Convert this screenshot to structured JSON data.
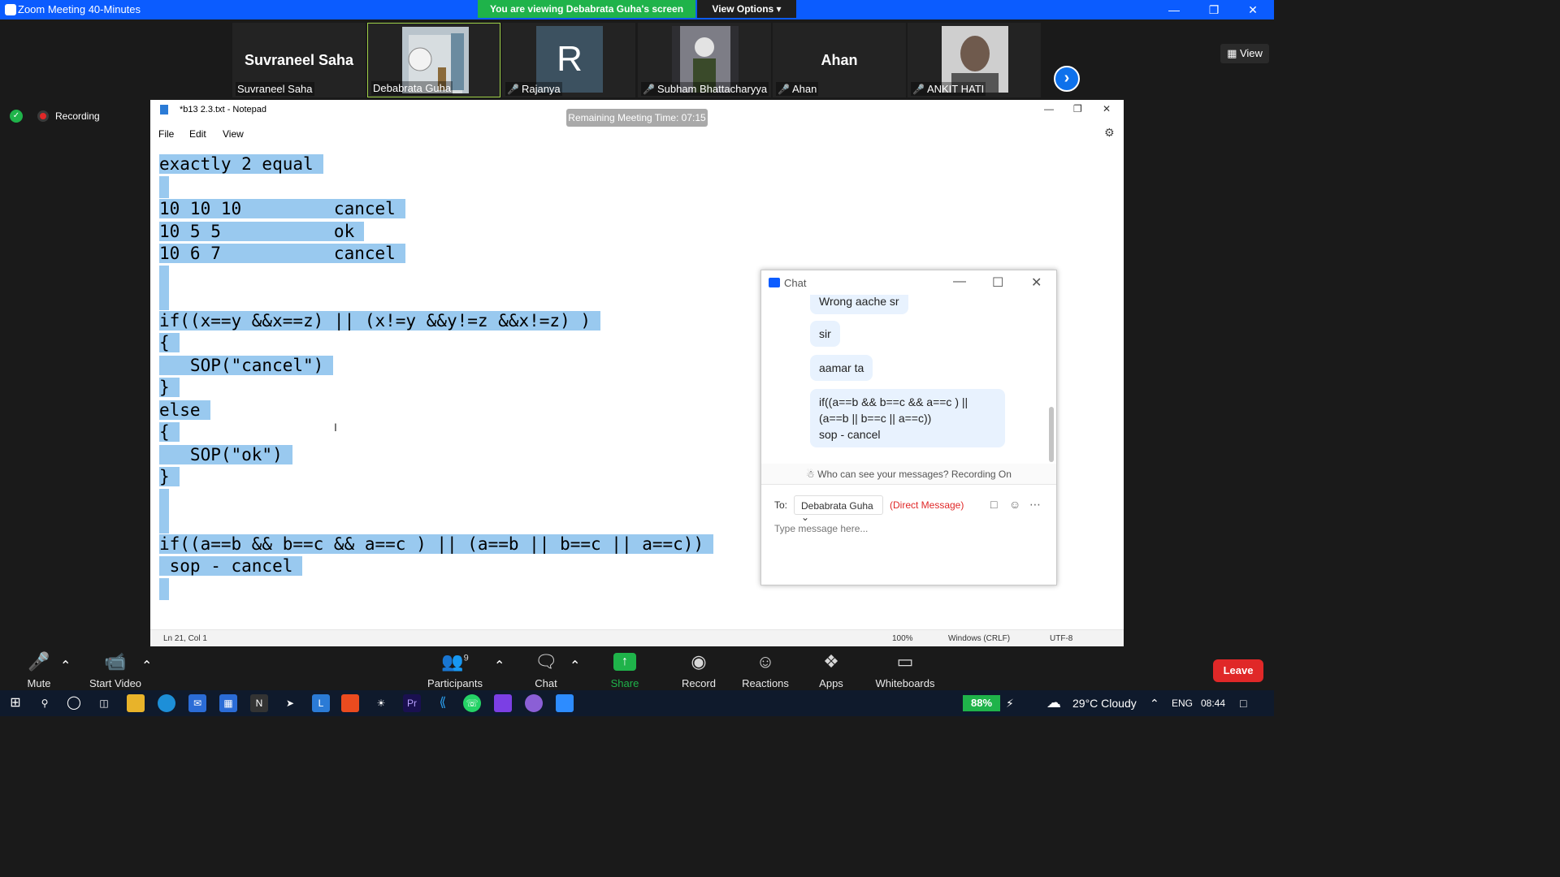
{
  "titlebar": {
    "title": "Zoom Meeting 40-Minutes",
    "viewing_banner": "You are viewing Debabrata Guha's screen",
    "view_options": "View Options ▾"
  },
  "gallery": {
    "participants": [
      {
        "big_name": "Suvraneel Saha",
        "name": "Suvraneel Saha",
        "muted": false
      },
      {
        "big_name": "",
        "name": "Debabrata Guha",
        "muted": false
      },
      {
        "big_name": "R",
        "name": "Rajanya",
        "muted": true
      },
      {
        "big_name": "",
        "name": "Subham Bhattacharyya",
        "muted": true
      },
      {
        "big_name": "Ahan",
        "name": "Ahan",
        "muted": true
      },
      {
        "big_name": "",
        "name": "ANKIT HATI",
        "muted": true
      }
    ],
    "view_label": "View"
  },
  "recording": {
    "label": "Recording"
  },
  "notepad": {
    "title": "*b13 2.3.txt - Notepad",
    "remaining_time": "Remaining Meeting Time: 07:15",
    "menu": [
      "File",
      "Edit",
      "View"
    ],
    "lines": [
      "exactly 2 equal",
      "",
      "10 10 10         cancel",
      "10 5 5           ok",
      "10 6 7           cancel",
      "",
      "",
      "if((x==y &&x==z) || (x!=y &&y!=z &&x!=z) )",
      "{",
      "   SOP(\"cancel\")",
      "}",
      "else",
      "{",
      "   SOP(\"ok\")",
      "}",
      "",
      "",
      "if((a==b && b==c && a==c ) || (a==b || b==c || a==c))",
      " sop - cancel",
      ""
    ],
    "status": {
      "position": "Ln 21, Col 1",
      "zoom": "100%",
      "line_ending": "Windows (CRLF)",
      "encoding": "UTF-8"
    }
  },
  "chat": {
    "title": "Chat",
    "messages": [
      "Wrong aache sr",
      "sir",
      "aamar ta",
      "if((a==b && b==c && a==c ) ||\n(a==b || b==c || a==c))\n sop - cancel"
    ],
    "visibility_note": "Who can see your messages? Recording On",
    "to_label": "To:",
    "to_recipient": "Debabrata Guha",
    "direct_message": "(Direct Message)",
    "input_placeholder": "Type message here..."
  },
  "toolbar": {
    "mute": "Mute",
    "start_video": "Start Video",
    "participants": "Participants",
    "participants_count": "9",
    "chat": "Chat",
    "share_screen": "Share Screen",
    "record": "Record",
    "reactions": "Reactions",
    "apps": "Apps",
    "whiteboards": "Whiteboards",
    "leave": "Leave"
  },
  "taskbar": {
    "battery": "88%",
    "weather": "29°C  Cloudy",
    "language": "ENG",
    "time": "08:44"
  },
  "colors": {
    "zoom_blue": "#0b5cff",
    "share_green": "#1fb34a",
    "leave_red": "#e02828",
    "selection": "#99c9ef"
  }
}
